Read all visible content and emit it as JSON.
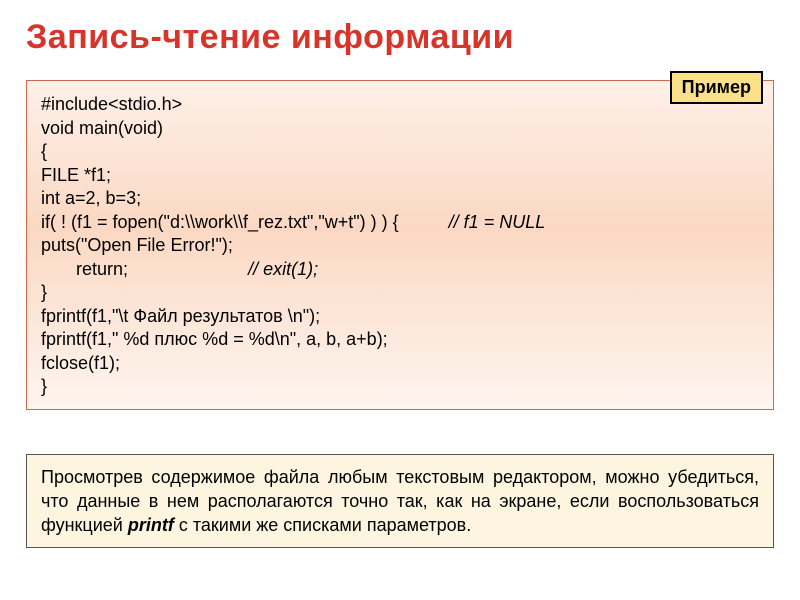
{
  "title": "Запись-чтение информации",
  "badge": "Пример",
  "code": {
    "l1": "#include<stdio.h>",
    "l2": "void main(void)",
    "l3": "{",
    "l4": "FILE *f1;",
    "l5": "int a=2, b=3;",
    "l6a": "if( ! (f1 = fopen(\"d:\\\\work\\\\f_rez.txt\",\"w+t\") ) ) {          ",
    "l6b": "// f1 = NULL",
    "l7": "puts(\"Open File Error!\");",
    "l8a": "       return;                        ",
    "l8b": "// exit(1);",
    "l9": "}",
    "l10": "fprintf(f1,\"\\t Файл результатов \\n\");",
    "l11": "fprintf(f1,\" %d плюс %d = %d\\n\", a, b, a+b);",
    "l12": "fclose(f1);",
    "l13": "}"
  },
  "explain": {
    "p1": "Просмотрев содержимое файла любым текстовым редактором, можно убедиться, что данные в нем располагаются точно так, как на экране, если воспользоваться функцией ",
    "pb": "printf",
    "p2": " с такими же списками параметров."
  }
}
